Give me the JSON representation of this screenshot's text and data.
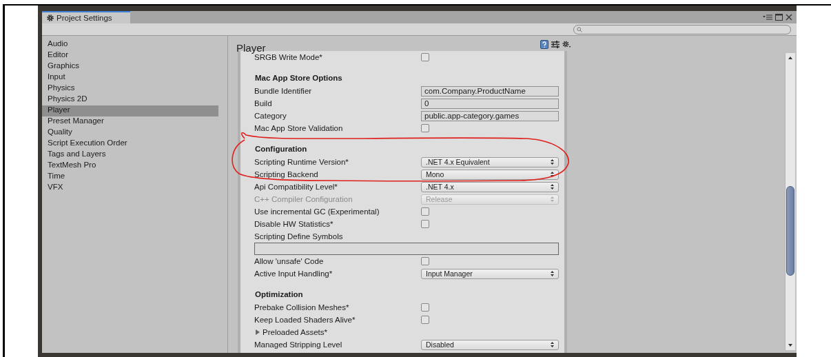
{
  "window": {
    "tab": "Project Settings",
    "selected": true
  },
  "sidebar": {
    "items": [
      {
        "label": "Audio",
        "selected": false
      },
      {
        "label": "Editor",
        "selected": false
      },
      {
        "label": "Graphics",
        "selected": false
      },
      {
        "label": "Input",
        "selected": false
      },
      {
        "label": "Physics",
        "selected": false
      },
      {
        "label": "Physics 2D",
        "selected": false
      },
      {
        "label": "Player",
        "selected": true
      },
      {
        "label": "Preset Manager",
        "selected": false
      },
      {
        "label": "Quality",
        "selected": false
      },
      {
        "label": "Script Execution Order",
        "selected": false
      },
      {
        "label": "Tags and Layers",
        "selected": false
      },
      {
        "label": "TextMesh Pro",
        "selected": false
      },
      {
        "label": "Time",
        "selected": false
      },
      {
        "label": "VFX",
        "selected": false
      }
    ]
  },
  "inspector": {
    "title": "Player",
    "rows": [
      {
        "kind": "checkbox",
        "label": "SRGB Write Mode*",
        "checked": false,
        "disabled": false
      },
      {
        "kind": "spacer"
      },
      {
        "kind": "header",
        "label": "Mac App Store Options"
      },
      {
        "kind": "text",
        "label": "Bundle Identifier",
        "value": "com.Company.ProductName"
      },
      {
        "kind": "text",
        "label": "Build",
        "value": "0"
      },
      {
        "kind": "text",
        "label": "Category",
        "value": "public.app-category.games"
      },
      {
        "kind": "checkbox",
        "label": "Mac App Store Validation",
        "checked": false,
        "disabled": false
      },
      {
        "kind": "spacer"
      },
      {
        "kind": "header",
        "label": "Configuration"
      },
      {
        "kind": "dropdown",
        "label": "Scripting Runtime Version*",
        "value": ".NET 4.x Equivalent",
        "disabled": false
      },
      {
        "kind": "dropdown",
        "label": "Scripting Backend",
        "value": "Mono",
        "disabled": false
      },
      {
        "kind": "dropdown",
        "label": "Api Compatibility Level*",
        "value": ".NET 4.x",
        "disabled": false
      },
      {
        "kind": "dropdown",
        "label": "C++ Compiler Configuration",
        "value": "Release",
        "disabled": true
      },
      {
        "kind": "checkbox",
        "label": "Use incremental GC (Experimental)",
        "checked": false,
        "disabled": false
      },
      {
        "kind": "checkbox",
        "label": "Disable HW Statistics*",
        "checked": false,
        "disabled": false
      },
      {
        "kind": "label",
        "label": "Scripting Define Symbols"
      },
      {
        "kind": "wide-text"
      },
      {
        "kind": "checkbox",
        "label": "Allow 'unsafe' Code",
        "checked": false,
        "disabled": false
      },
      {
        "kind": "dropdown",
        "label": "Active Input Handling*",
        "value": "Input Manager",
        "disabled": false
      },
      {
        "kind": "spacer"
      },
      {
        "kind": "header",
        "label": "Optimization"
      },
      {
        "kind": "checkbox",
        "label": "Prebake Collision Meshes*",
        "checked": false,
        "disabled": false
      },
      {
        "kind": "checkbox",
        "label": "Keep Loaded Shaders Alive*",
        "checked": false,
        "disabled": false
      },
      {
        "kind": "foldout",
        "label": "Preloaded Assets*",
        "expanded": false
      },
      {
        "kind": "dropdown",
        "label": "Managed Stripping Level",
        "value": "Disabled",
        "disabled": false
      }
    ]
  },
  "annotation": {
    "kind": "ellipse"
  }
}
